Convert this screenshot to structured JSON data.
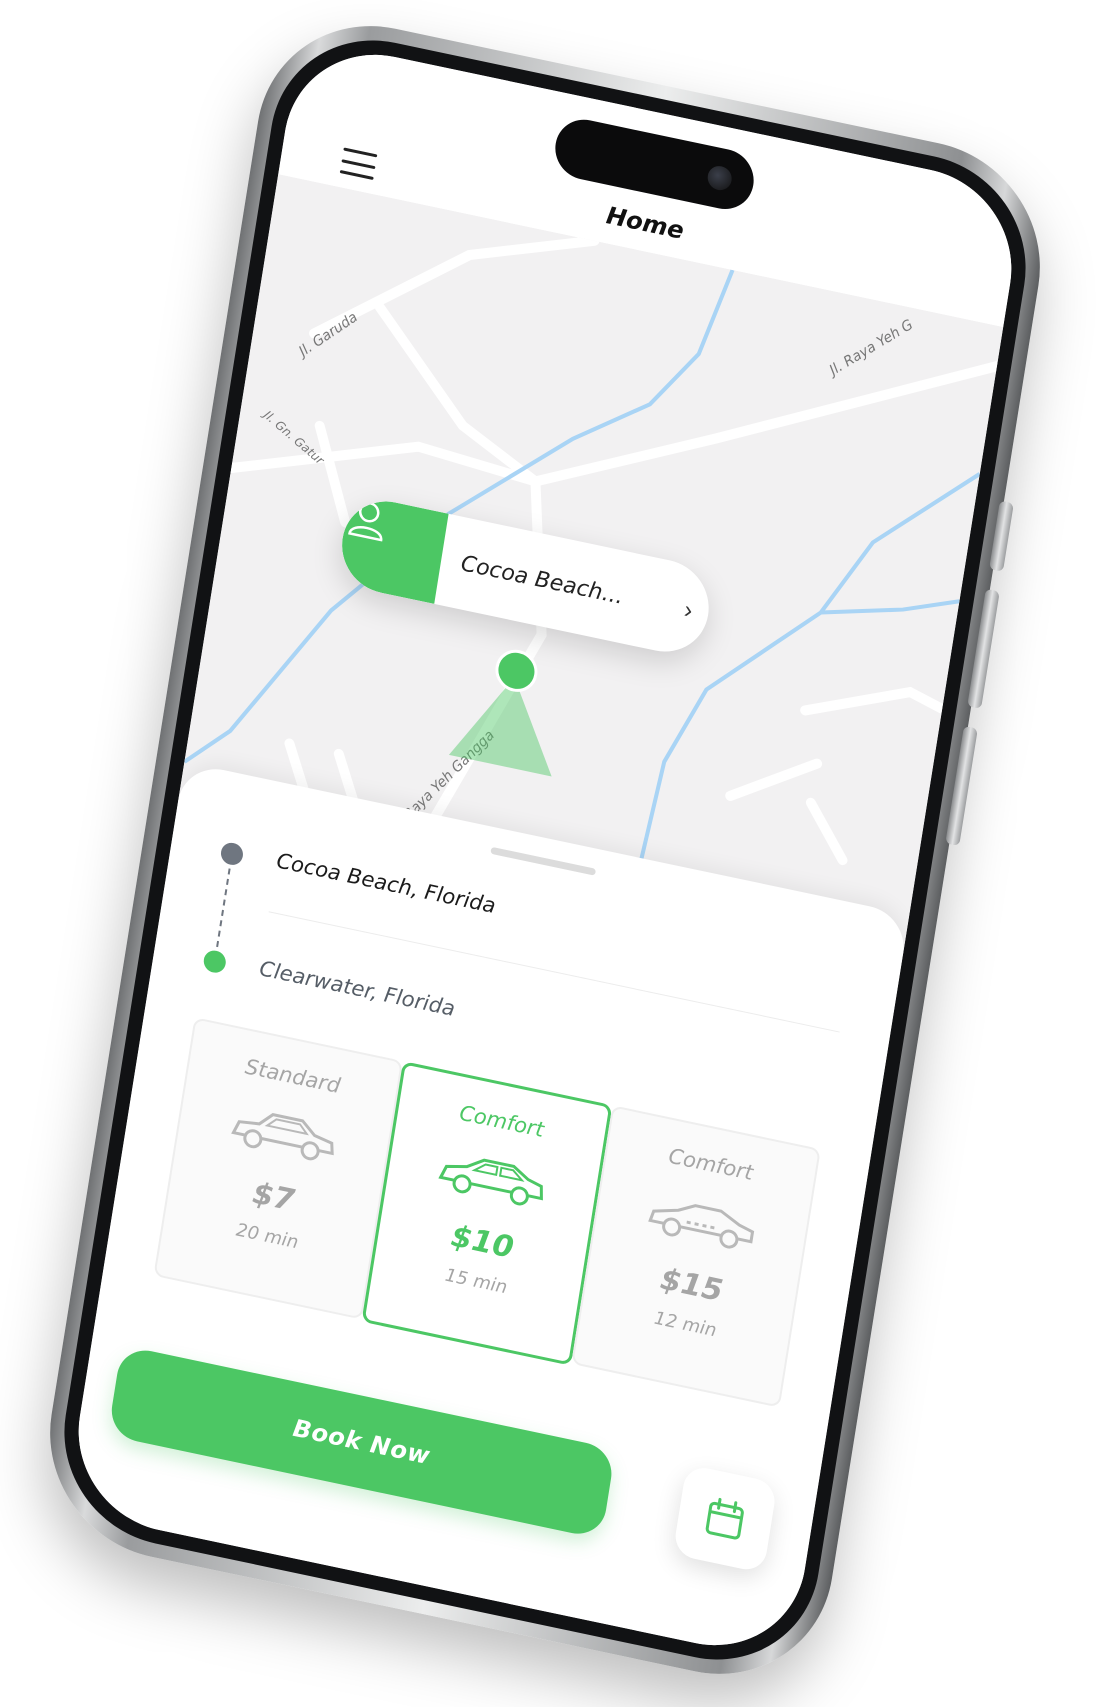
{
  "header": {
    "title": "Home"
  },
  "map": {
    "street_labels": [
      "Jl. Garuda",
      "Jl. Gn. Gatur",
      "Jl. Raya Yeh G",
      "Raya Yeh Gangga"
    ],
    "location_pill": {
      "text": "Cocoa Beach...",
      "icon": "user-icon",
      "chevron": "chevron-right-icon"
    }
  },
  "route": {
    "from": "Cocoa Beach, Florida",
    "to": "Clearwater, Florida"
  },
  "rides": [
    {
      "name": "Standard",
      "price": "$7",
      "time": "20 min",
      "selected": false
    },
    {
      "name": "Comfort",
      "price": "$10",
      "time": "15 min",
      "selected": true
    },
    {
      "name": "Comfort",
      "price": "$15",
      "time": "12 min",
      "selected": false
    }
  ],
  "actions": {
    "book_label": "Book Now",
    "calendar_icon": "calendar-icon"
  },
  "colors": {
    "accent": "#4cc764",
    "map_bg": "#f2f1f2",
    "water": "#a9d4f5",
    "muted": "#a5a5a5"
  }
}
